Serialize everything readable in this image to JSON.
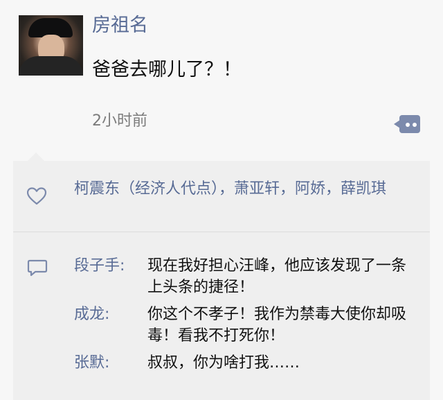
{
  "post": {
    "username": "房祖名",
    "content": "爸爸去哪儿了？！",
    "time": "2小时前"
  },
  "likes": {
    "names": "柯震东（经济人代点），萧亚轩，阿娇，薛凯琪"
  },
  "comments": [
    {
      "author": "段子手:",
      "text": "现在我好担心汪峰，他应该发现了一条上头条的捷径！"
    },
    {
      "author": "成龙:",
      "text": "你这个不孝子！我作为禁毒大使你却吸毒！看我不打死你！"
    },
    {
      "author": "张默:",
      "text": "叔叔，你为啥打我……"
    }
  ],
  "icons": {
    "more": "more-icon",
    "like": "heart-icon",
    "comment": "comment-icon"
  },
  "colors": {
    "link": "#586b95",
    "more_button": "#7c8aac",
    "panel": "#efefef",
    "background": "#f7f7f7"
  }
}
